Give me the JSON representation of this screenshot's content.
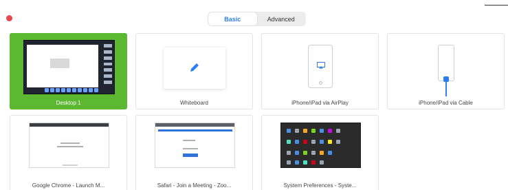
{
  "window": {
    "close_color": "#e8484b"
  },
  "segmented": {
    "basic_label": "Basic",
    "advanced_label": "Advanced",
    "active": "Basic"
  },
  "tiles": [
    {
      "label": "Desktop 1",
      "selected": true
    },
    {
      "label": "Whiteboard",
      "selected": false
    },
    {
      "label": "iPhone/iPad via AirPlay",
      "selected": false
    },
    {
      "label": "iPhone/iPad via Cable",
      "selected": false
    },
    {
      "label": "Google Chrome - Launch M...",
      "selected": false
    },
    {
      "label": "Safari - Join a Meeting - Zoo...",
      "selected": false
    },
    {
      "label": "System Preferences - Syste...",
      "selected": false
    }
  ],
  "colors": {
    "accent": "#2d7df6",
    "selected": "#5bb830"
  }
}
